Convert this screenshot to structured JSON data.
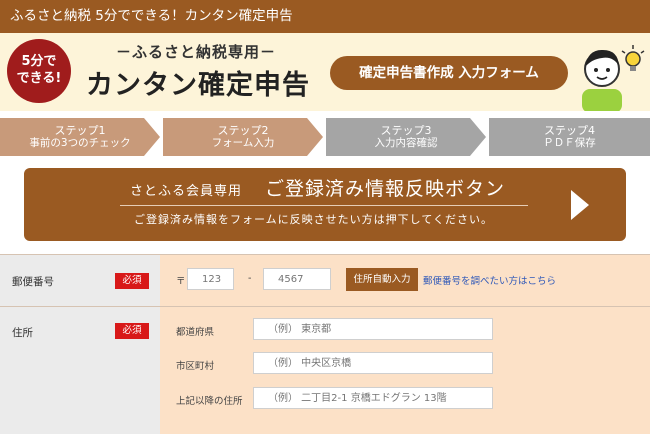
{
  "topbar": {
    "title": "ふるさと納税 5分でできる！カンタン確定申告"
  },
  "hero": {
    "badge_line1": "5分で",
    "badge_line2": "できる!",
    "subtitle": "－ふるさと納税専用－",
    "title": "カンタン確定申告",
    "pill": "確定申告書作成 入力フォーム"
  },
  "steps": [
    {
      "num": "ステップ1",
      "label": "事前の3つのチェック",
      "state": "done"
    },
    {
      "num": "ステップ2",
      "label": "フォーム入力",
      "state": "active"
    },
    {
      "num": "ステップ3",
      "label": "入力内容確認",
      "state": "todo"
    },
    {
      "num": "ステップ4",
      "label": "ＰＤＦ保存",
      "state": "todo"
    }
  ],
  "cta": {
    "label": "さとふる会員専用",
    "title": "ご登録済み情報反映ボタン",
    "desc": "ご登録済み情報をフォームに反映させたい方は押下してください。"
  },
  "postal": {
    "label": "郵便番号",
    "required": "必須",
    "mark": "〒",
    "part1_placeholder": "123",
    "dash": "-",
    "part2_placeholder": "4567",
    "auto_button": "住所自動入力",
    "lookup_link": "郵便番号を調べたい方はこちら"
  },
  "address": {
    "label": "住所",
    "required": "必須",
    "prefecture_label": "都道府県",
    "prefecture_placeholder": "（例） 東京都",
    "city_label": "市区町村",
    "city_placeholder": "（例） 中央区京橋",
    "street_label": "上記以降の住所",
    "street_placeholder": "（例） 二丁目2-1 京橋エドグラン 13階"
  },
  "colors": {
    "brand": "#9a5a22",
    "required": "#d81919",
    "step_done": "#c89a7a",
    "step_todo": "#a5a5a5",
    "field_bg": "#fce1c7"
  }
}
